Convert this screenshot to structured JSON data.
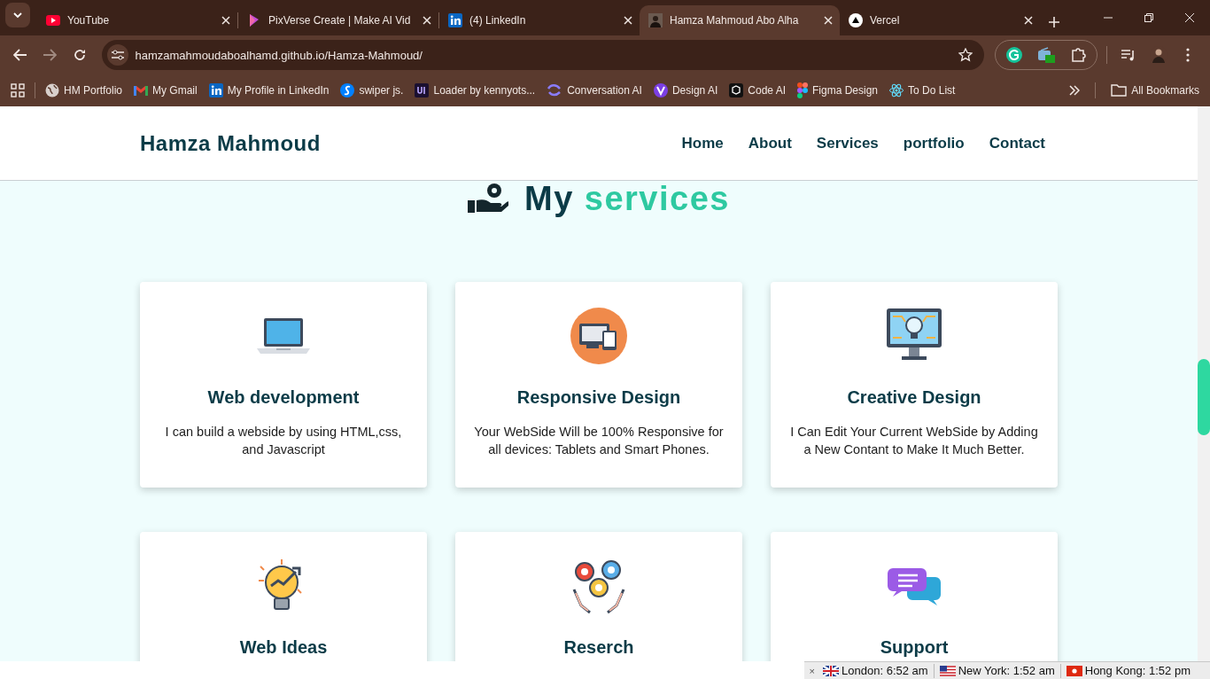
{
  "browser": {
    "tabs": [
      {
        "title": "YouTube",
        "selected": false
      },
      {
        "title": "PixVerse Create | Make AI Vid",
        "selected": false
      },
      {
        "title": "(4) LinkedIn",
        "selected": false
      },
      {
        "title": "Hamza Mahmoud Abo Alha",
        "selected": true
      },
      {
        "title": "Vercel",
        "selected": false
      }
    ],
    "address": "hamzamahmoudaboalhamd.github.io/Hamza-Mahmoud/",
    "bookmarks": [
      {
        "label": "HM Portfolio"
      },
      {
        "label": "My Gmail"
      },
      {
        "label": "My Profile in LinkedIn"
      },
      {
        "label": "swiper js."
      },
      {
        "label": "Loader by kennyots..."
      },
      {
        "label": "Conversation AI"
      },
      {
        "label": "Design AI"
      },
      {
        "label": "Code AI"
      },
      {
        "label": "Figma Design"
      },
      {
        "label": "To Do List"
      }
    ],
    "all_bookmarks": "All Bookmarks"
  },
  "site": {
    "brand": "Hamza Mahmoud",
    "nav": [
      {
        "label": "Home"
      },
      {
        "label": "About"
      },
      {
        "label": "Services"
      },
      {
        "label": "portfolio"
      },
      {
        "label": "Contact"
      }
    ],
    "heading": {
      "lead": "My",
      "accent": "services"
    },
    "services": [
      {
        "title": "Web development",
        "text": "I can build a webside by using HTML,css, and Javascript"
      },
      {
        "title": "Responsive Design",
        "text": "Your WebSide Will be 100% Responsive for all devices: Tablets and Smart Phones."
      },
      {
        "title": "Creative Design",
        "text": "I Can Edit Your Current WebSide by Adding a New Contant to Make It Much Better."
      },
      {
        "title": "Web Ideas"
      },
      {
        "title": "Reserch"
      },
      {
        "title": "Support"
      }
    ]
  },
  "clock_bar": {
    "close": "×",
    "clocks": [
      {
        "label": "London: 6:52 am"
      },
      {
        "label": "New York: 1:52 am"
      },
      {
        "label": "Hong Kong: 1:52 pm"
      }
    ]
  }
}
